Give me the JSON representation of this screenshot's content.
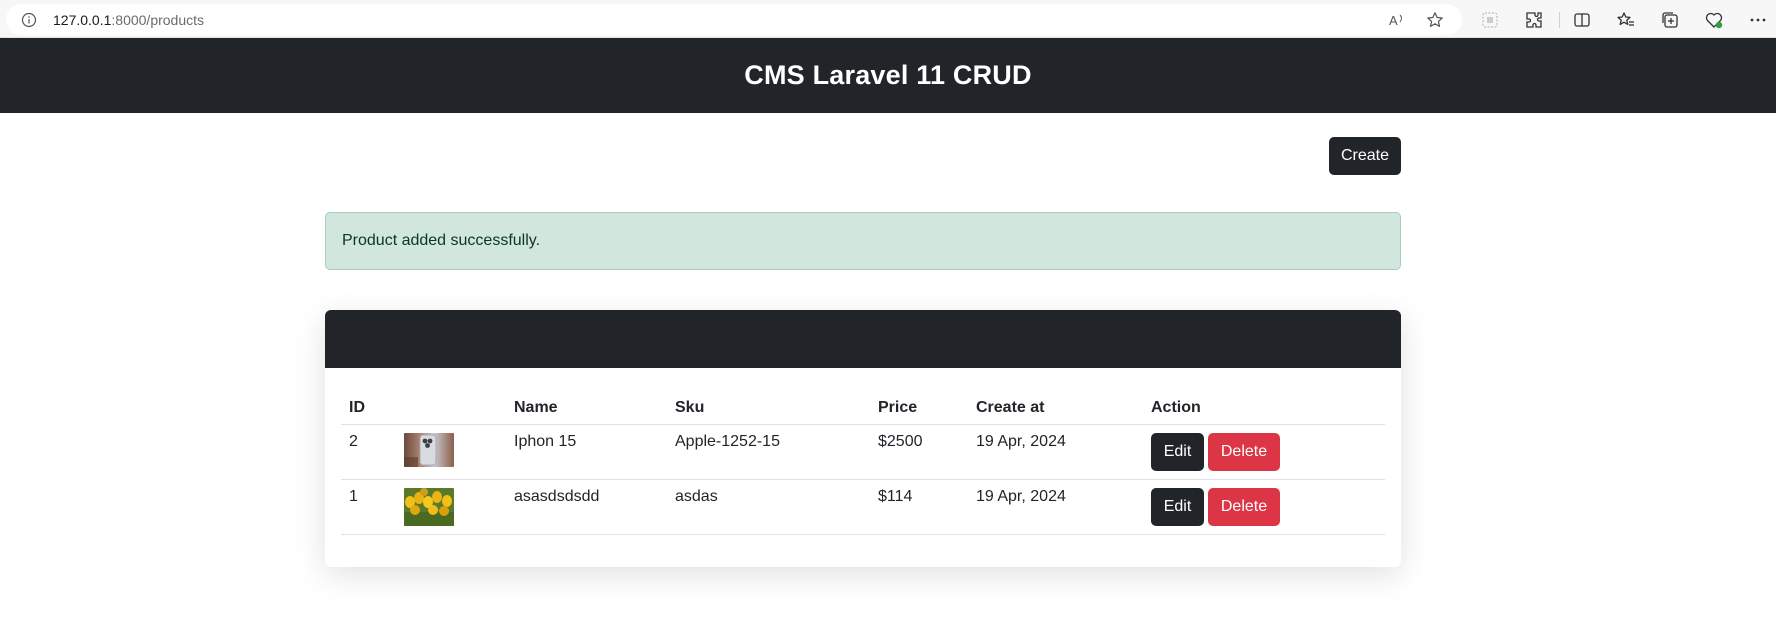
{
  "browser": {
    "url_host": "127.0.0.1",
    "url_path": ":8000/products",
    "icons": [
      "info-icon",
      "read-aloud-icon",
      "favorite-star-icon",
      "split-screen-icon",
      "extensions-icon",
      "sidebar-split-icon",
      "favorites-icon",
      "collections-icon",
      "browser-essentials-icon",
      "more-menu-icon"
    ]
  },
  "header": {
    "title": "CMS Laravel 11 CRUD"
  },
  "toolbar": {
    "create_label": "Create"
  },
  "alert": {
    "message": "Product added successfully."
  },
  "table": {
    "columns": [
      "ID",
      "",
      "Name",
      "Sku",
      "Price",
      "Create at",
      "Action"
    ],
    "rows": [
      {
        "id": "2",
        "name": "Iphon 15",
        "sku": "Apple-1252-15",
        "price": "$2500",
        "created_at": "19 Apr, 2024",
        "edit_label": "Edit",
        "delete_label": "Delete"
      },
      {
        "id": "1",
        "name": "asasdsdsdd",
        "sku": "asdas",
        "price": "$114",
        "created_at": "19 Apr, 2024",
        "edit_label": "Edit",
        "delete_label": "Delete"
      }
    ]
  },
  "colors": {
    "dark": "#212529",
    "danger": "#dc3545",
    "success_bg": "#d1e7dd",
    "success_text": "#0a3622"
  }
}
